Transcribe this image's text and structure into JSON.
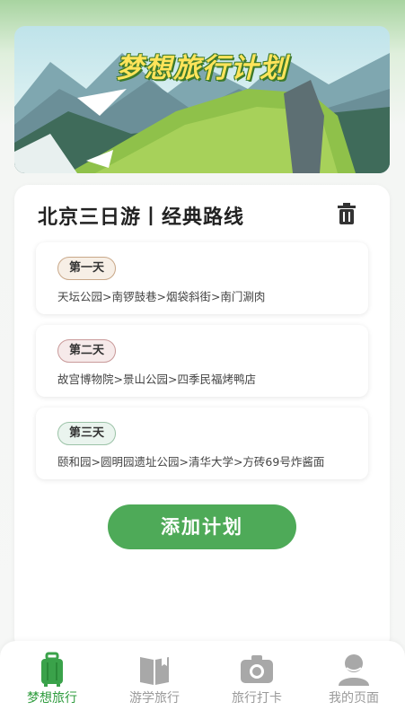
{
  "banner": {
    "title": "梦想旅行计划"
  },
  "plan": {
    "title": "北京三日游丨经典路线",
    "days": [
      {
        "label": "第一天",
        "route": "天坛公园>南锣鼓巷>烟袋斜街>南门涮肉",
        "badge_color": "#f7efe6",
        "badge_border": "#c9a889"
      },
      {
        "label": "第二天",
        "route": "故宫博物院>景山公园>四季民福烤鸭店",
        "badge_color": "#f6eaea",
        "badge_border": "#c99a9a"
      },
      {
        "label": "第三天",
        "route": "颐和园>圆明园遗址公园>清华大学>方砖69号炸酱面",
        "badge_color": "#eaf4ee",
        "badge_border": "#9cc3a8"
      }
    ],
    "add_button": "添加计划"
  },
  "tabs": [
    {
      "label": "梦想旅行",
      "icon": "suitcase-icon",
      "active": true
    },
    {
      "label": "游学旅行",
      "icon": "book-icon",
      "active": false
    },
    {
      "label": "旅行打卡",
      "icon": "camera-icon",
      "active": false
    },
    {
      "label": "我的页面",
      "icon": "user-icon",
      "active": false
    }
  ],
  "colors": {
    "accent": "#4eaa58",
    "active_tab": "#2f9c3e",
    "inactive_tab": "#9a9a9a"
  }
}
